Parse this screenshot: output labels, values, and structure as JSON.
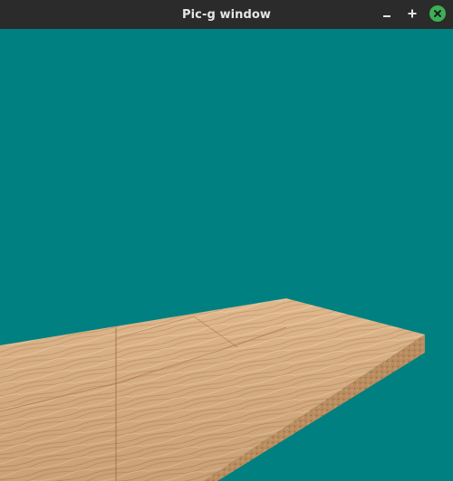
{
  "window": {
    "title": "Pic-g window"
  },
  "titlebar_controls": {
    "minimize_icon": "minimize-icon",
    "maximize_icon": "maximize-icon",
    "close_icon": "close-icon"
  },
  "colors": {
    "titlebar_bg": "#2b2b2b",
    "scene_bg": "#008080",
    "close_button": "#3bb054",
    "wood_light": "#e2b88a",
    "wood_mid": "#cfa070",
    "wood_dark": "#b98656"
  }
}
